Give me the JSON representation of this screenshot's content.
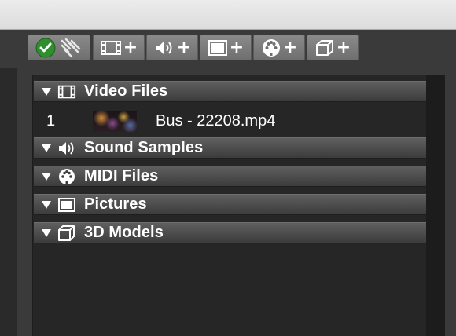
{
  "toolbar": {
    "buttons": [
      {
        "name": "toggle-button",
        "icon": "check-circle-icon"
      },
      {
        "name": "add-video-button",
        "icon": "film-icon",
        "plus": "+"
      },
      {
        "name": "add-sound-button",
        "icon": "speaker-icon",
        "plus": "+"
      },
      {
        "name": "add-picture-button",
        "icon": "picture-icon",
        "plus": "+"
      },
      {
        "name": "add-midi-button",
        "icon": "midi-icon",
        "plus": "+"
      },
      {
        "name": "add-3d-model-button",
        "icon": "cube-icon",
        "plus": "+"
      }
    ]
  },
  "groups": [
    {
      "label": "Video Files",
      "icon": "film-icon",
      "expanded": true
    },
    {
      "label": "Sound Samples",
      "icon": "speaker-icon",
      "expanded": true
    },
    {
      "label": "MIDI Files",
      "icon": "midi-icon",
      "expanded": true
    },
    {
      "label": "Pictures",
      "icon": "picture-icon",
      "expanded": true
    },
    {
      "label": "3D Models",
      "icon": "cube-icon",
      "expanded": true
    }
  ],
  "video_files": [
    {
      "index": "1",
      "name": "Bus - 22208.mp4",
      "thumbnail": "video-thumbnail"
    }
  ],
  "colors": {
    "accent_green": "#2f8f2f",
    "header_text": "#ffffff",
    "panel_bg": "#262626"
  }
}
